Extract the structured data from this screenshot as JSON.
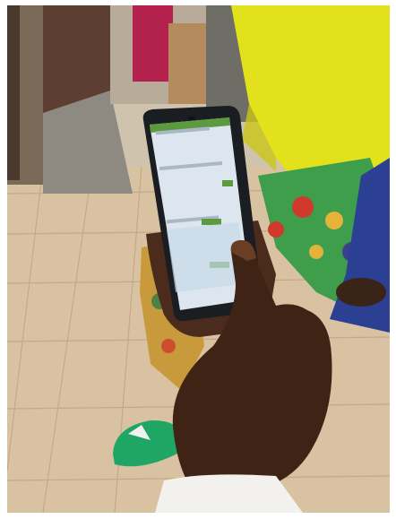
{
  "photo": {
    "scene": "photo-hand-using-smartphone",
    "colors": {
      "floor": "#d9c3a3",
      "wall": "#5a4434",
      "yellow_cloth": "#e4e21b",
      "skin": "#4a2b1a",
      "phone_body": "#1b1f24",
      "phone_screen": "#d7e1ea",
      "app_green": "#5b9a3e",
      "sandal": "#22a864"
    }
  },
  "phone": {
    "status_text": "",
    "buttons": [
      "",
      "",
      ""
    ],
    "input_lines": [
      "",
      "",
      ""
    ]
  },
  "sandal": {
    "label": ""
  }
}
